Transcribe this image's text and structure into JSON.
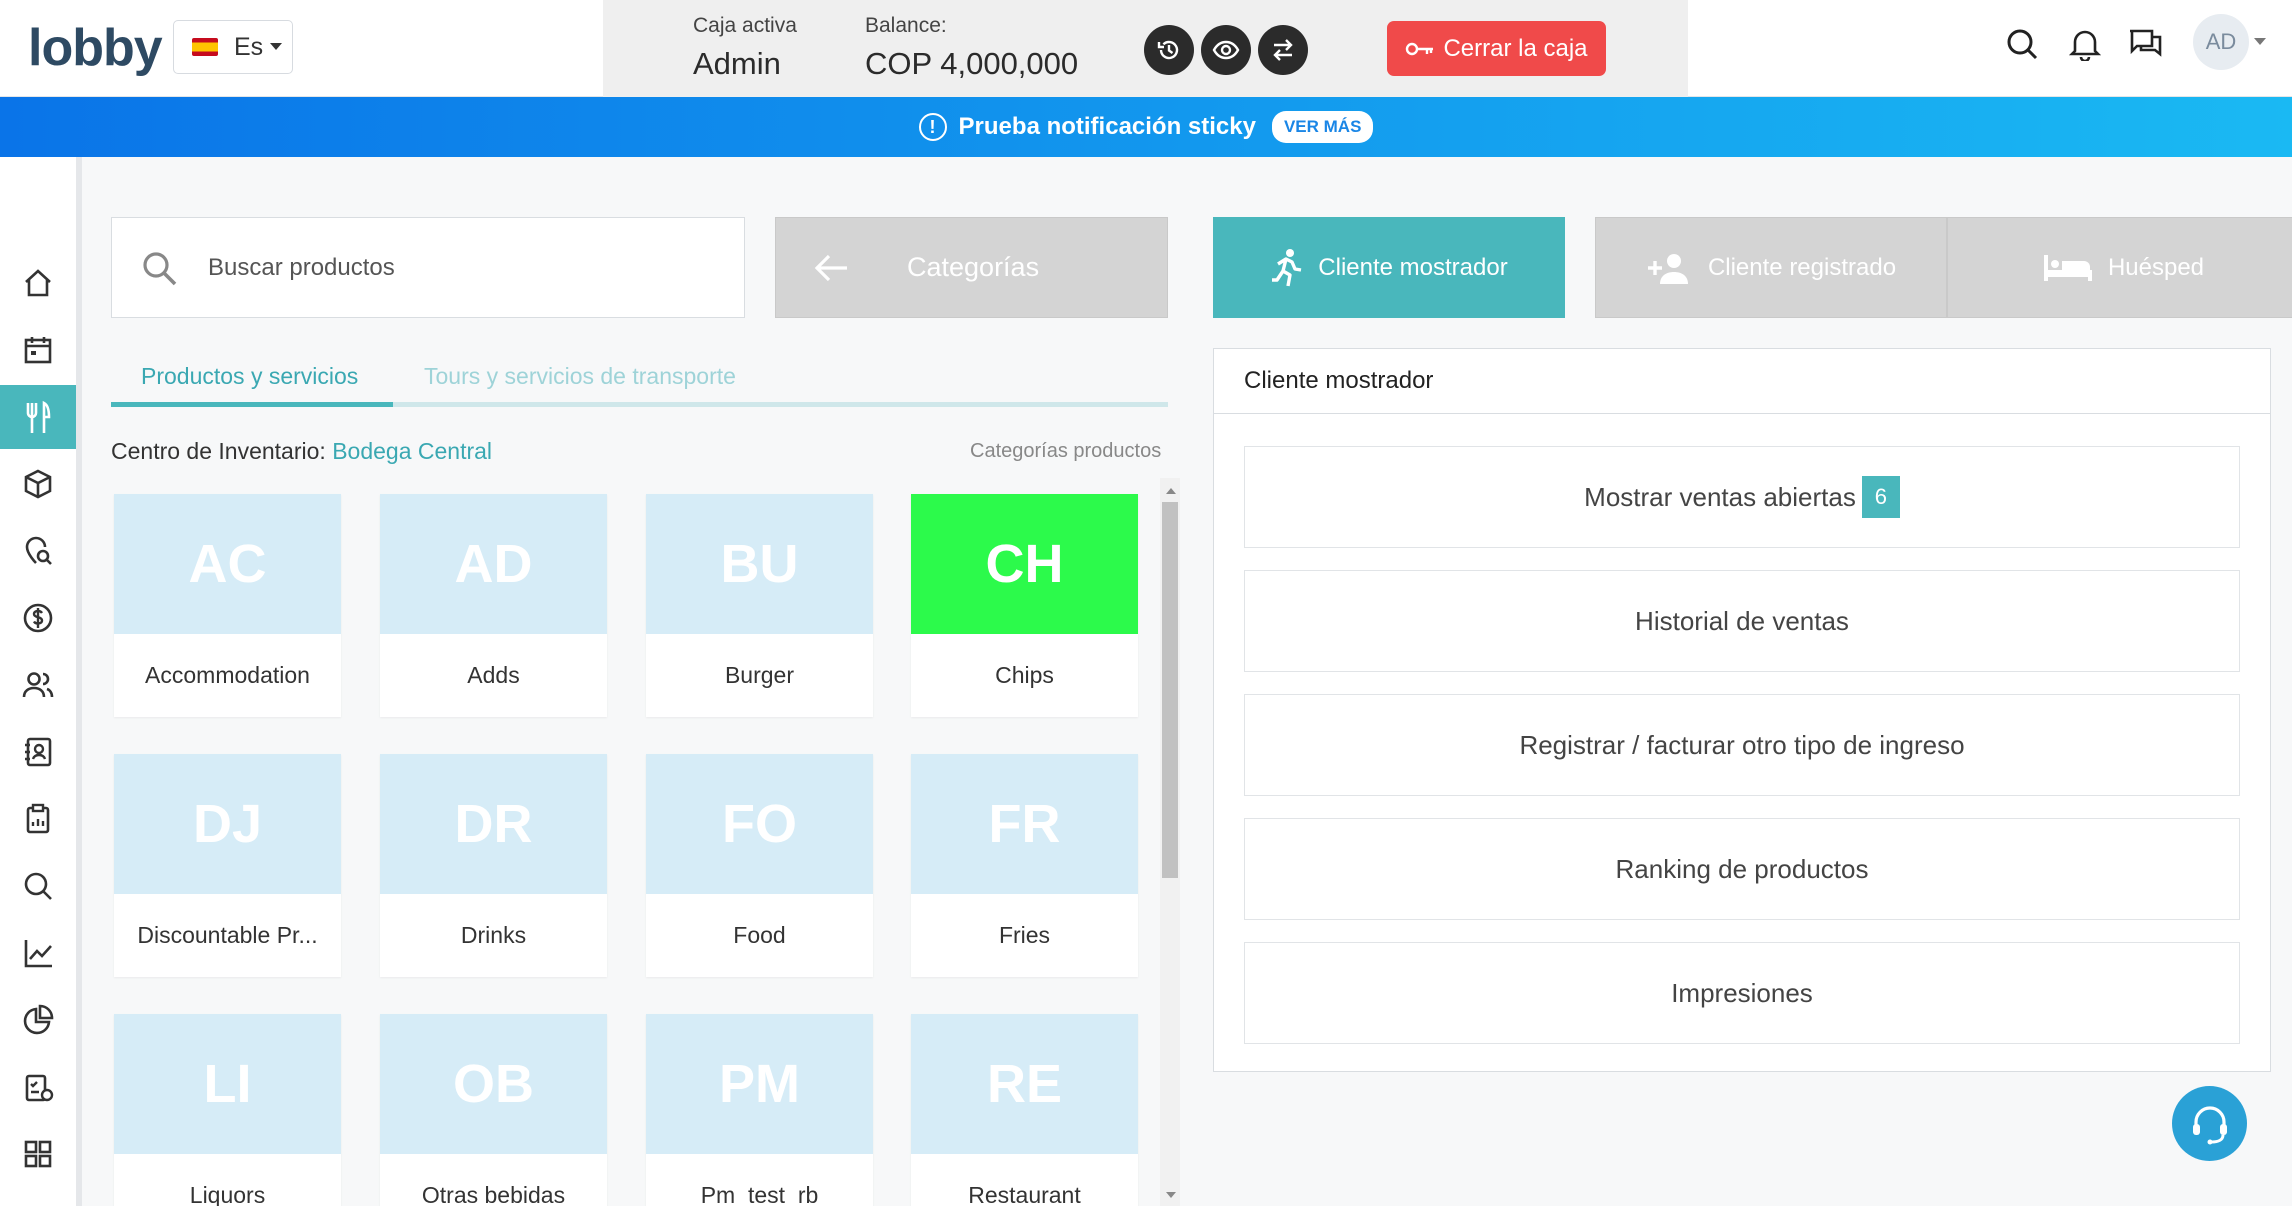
{
  "header": {
    "logo_text": "lobby",
    "language": "Es",
    "caja_label": "Caja activa",
    "caja_value": "Admin",
    "balance_label": "Balance:",
    "balance_value": "COP 4,000,000",
    "close_button": "Cerrar la caja",
    "avatar_initials": "AD"
  },
  "notification": {
    "text": "Prueba notificación sticky",
    "more_label": "VER MÁS"
  },
  "sidebar": {
    "items": [
      "home-icon",
      "calendar-icon",
      "fork-knife-icon",
      "box-icon",
      "location-search-icon",
      "dollar-icon",
      "users-icon",
      "contacts-icon",
      "clipboard-icon",
      "search-icon",
      "chart-line-icon",
      "pie-chart-icon",
      "checklist-icon",
      "grid-icon"
    ],
    "active_index": 2
  },
  "products": {
    "search_placeholder": "Buscar productos",
    "categories_button": "Categorías",
    "tabs": [
      "Productos y servicios",
      "Tours y servicios de transporte"
    ],
    "inventory_label": "Centro de Inventario:",
    "inventory_value": "Bodega Central",
    "categories_link": "Categorías productos",
    "items": [
      {
        "code": "AC",
        "name": "Accommodation",
        "highlight": false
      },
      {
        "code": "AD",
        "name": "Adds",
        "highlight": false
      },
      {
        "code": "BU",
        "name": "Burger",
        "highlight": false
      },
      {
        "code": "CH",
        "name": "Chips",
        "highlight": true
      },
      {
        "code": "DJ",
        "name": "Discountable Pr...",
        "highlight": false
      },
      {
        "code": "DR",
        "name": "Drinks",
        "highlight": false
      },
      {
        "code": "FO",
        "name": "Food",
        "highlight": false
      },
      {
        "code": "FR",
        "name": "Fries",
        "highlight": false
      },
      {
        "code": "LI",
        "name": "Liquors",
        "highlight": false
      },
      {
        "code": "OB",
        "name": "Otras bebidas",
        "highlight": false
      },
      {
        "code": "PM",
        "name": "Pm_test_rb",
        "highlight": false
      },
      {
        "code": "RE",
        "name": "Restaurant",
        "highlight": false
      }
    ]
  },
  "customer": {
    "buttons": [
      "Cliente mostrador",
      "Cliente registrado",
      "Huésped"
    ],
    "panel_title": "Cliente mostrador",
    "options": [
      "Mostrar ventas abiertas",
      "Historial de ventas",
      "Registrar / facturar otro tipo de ingreso",
      "Ranking de productos",
      "Impresiones"
    ],
    "open_sales_count": "6"
  },
  "colors": {
    "accent": "#49b7bc",
    "danger": "#f04a4a",
    "highlight_tile": "#2cfa4b",
    "tile": "#d6ecf7"
  }
}
